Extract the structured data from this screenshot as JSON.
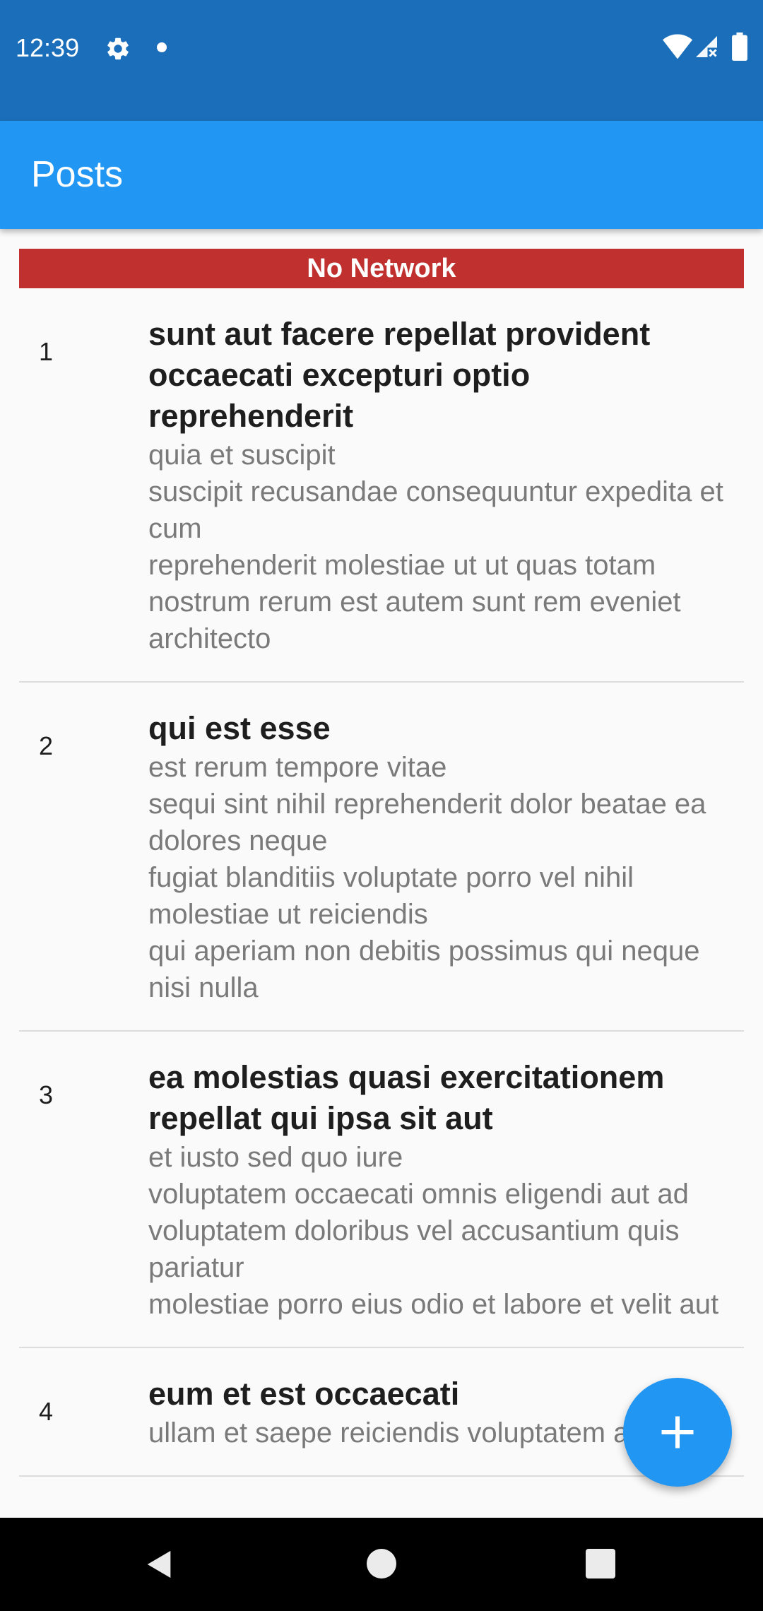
{
  "status_bar": {
    "time": "12:39",
    "icons": [
      "gear-icon",
      "notification-dot-icon",
      "wifi-icon",
      "signal-icon",
      "battery-icon"
    ],
    "color": "#1b6fba"
  },
  "app_bar": {
    "title": "Posts",
    "color": "#2196f3"
  },
  "banner": {
    "text": "No Network",
    "color": "#c0302f"
  },
  "posts": [
    {
      "id": "1",
      "title": "sunt aut facere repellat provident occaecati excepturi optio reprehenderit",
      "body": "quia et suscipit\nsuscipit recusandae consequuntur expedita et cum\nreprehenderit molestiae ut ut quas totam\nnostrum rerum est autem sunt rem eveniet architecto"
    },
    {
      "id": "2",
      "title": "qui est esse",
      "body": "est rerum tempore vitae\nsequi sint nihil reprehenderit dolor beatae ea dolores neque\nfugiat blanditiis voluptate porro vel nihil molestiae ut reiciendis\nqui aperiam non debitis possimus qui neque nisi nulla"
    },
    {
      "id": "3",
      "title": "ea molestias quasi exercitationem repellat qui ipsa sit aut",
      "body": "et iusto sed quo iure\nvoluptatem occaecati omnis eligendi aut ad\nvoluptatem doloribus vel accusantium quis pariatur\nmolestiae porro eius odio et labore et velit aut"
    },
    {
      "id": "4",
      "title": "eum et est occaecati",
      "body": "ullam et saepe reiciendis voluptatem adipisci"
    }
  ],
  "fab": {
    "icon": "plus-icon"
  },
  "nav_bar": {
    "icons": [
      "back-icon",
      "home-icon",
      "recents-icon"
    ]
  }
}
